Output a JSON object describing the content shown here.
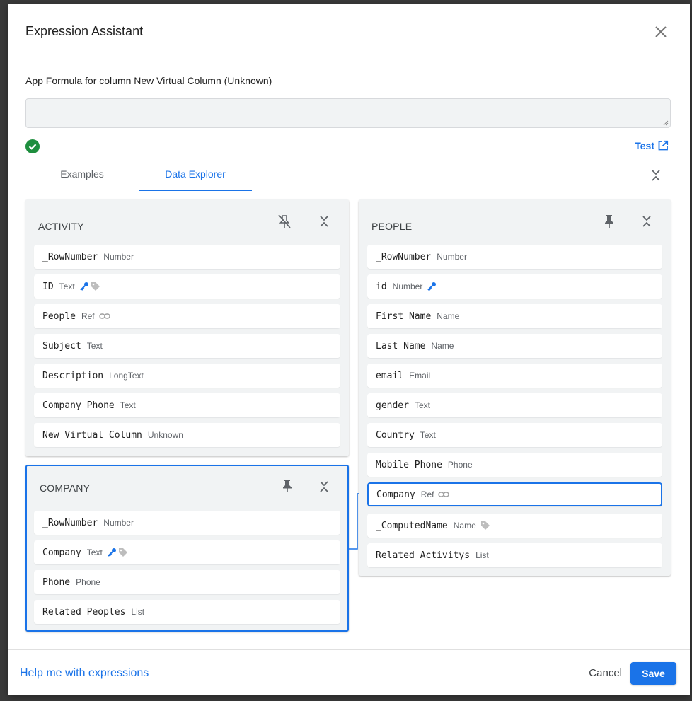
{
  "dialog": {
    "title": "Expression Assistant",
    "close_icon": "close-icon"
  },
  "formula": {
    "label": "App Formula for column New Virtual Column (Unknown)",
    "value": "",
    "status_icon": "check-circle-icon",
    "test_label": "Test"
  },
  "tabs": [
    {
      "label": "Examples",
      "active": false
    },
    {
      "label": "Data Explorer",
      "active": true
    }
  ],
  "tables": {
    "activity": {
      "title": "ACTIVITY",
      "pinned": false,
      "columns": [
        {
          "name": "_RowNumber",
          "type": "Number"
        },
        {
          "name": "ID",
          "type": "Text",
          "icons": [
            "key-icon",
            "tag-icon"
          ]
        },
        {
          "name": "People",
          "type": "Ref",
          "icons": [
            "link-icon"
          ]
        },
        {
          "name": "Subject",
          "type": "Text"
        },
        {
          "name": "Description",
          "type": "LongText"
        },
        {
          "name": "Company Phone",
          "type": "Text"
        },
        {
          "name": "New Virtual Column",
          "type": "Unknown"
        }
      ]
    },
    "company": {
      "title": "COMPANY",
      "pinned": true,
      "selected": true,
      "columns": [
        {
          "name": "_RowNumber",
          "type": "Number"
        },
        {
          "name": "Company",
          "type": "Text",
          "icons": [
            "key-icon",
            "tag-icon"
          ]
        },
        {
          "name": "Phone",
          "type": "Phone"
        },
        {
          "name": "Related Peoples",
          "type": "List"
        }
      ]
    },
    "people": {
      "title": "PEOPLE",
      "pinned": true,
      "columns": [
        {
          "name": "_RowNumber",
          "type": "Number"
        },
        {
          "name": "id",
          "type": "Number",
          "icons": [
            "key-icon"
          ]
        },
        {
          "name": "First Name",
          "type": "Name"
        },
        {
          "name": "Last Name",
          "type": "Name"
        },
        {
          "name": "email",
          "type": "Email"
        },
        {
          "name": "gender",
          "type": "Text"
        },
        {
          "name": "Country",
          "type": "Text"
        },
        {
          "name": "Mobile Phone",
          "type": "Phone"
        },
        {
          "name": "Company",
          "type": "Ref",
          "icons": [
            "link-icon"
          ],
          "highlighted": true
        },
        {
          "name": "_ComputedName",
          "type": "Name",
          "icons": [
            "tag-icon"
          ]
        },
        {
          "name": "Related Activitys",
          "type": "List"
        }
      ]
    }
  },
  "footer": {
    "help_label": "Help me with expressions",
    "cancel_label": "Cancel",
    "save_label": "Save"
  },
  "colors": {
    "accent": "#1a73e8",
    "success": "#1e8e3e",
    "panel_bg": "#f1f3f4"
  }
}
